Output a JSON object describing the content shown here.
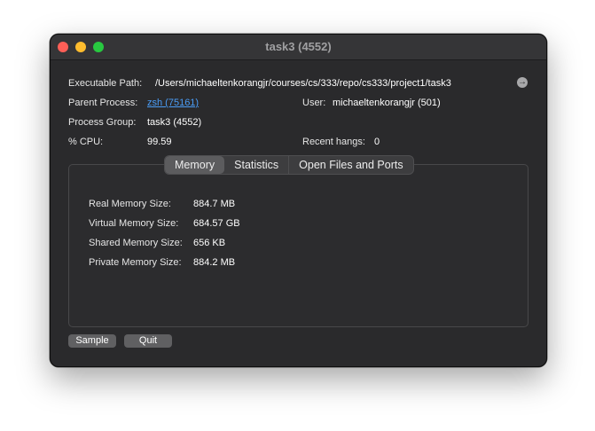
{
  "window": {
    "title": "task3 (4552)"
  },
  "info": {
    "executable_path_label": "Executable Path:",
    "executable_path_value": "/Users/michaeltenkorangjr/courses/cs/333/repo/cs333/project1/task3",
    "parent_process_label": "Parent Process:",
    "parent_process_value": "zsh (75161)",
    "user_label": "User:",
    "user_value": "michaeltenkorangjr (501)",
    "process_group_label": "Process Group:",
    "process_group_value": "task3 (4552)",
    "cpu_label": "% CPU:",
    "cpu_value": "99.59",
    "recent_hangs_label": "Recent hangs:",
    "recent_hangs_value": "0",
    "reveal_icon": "arrow-right-circle-icon"
  },
  "tabs": [
    {
      "label": "Memory",
      "selected": true
    },
    {
      "label": "Statistics",
      "selected": false
    },
    {
      "label": "Open Files and Ports",
      "selected": false
    }
  ],
  "memory": {
    "real_label": "Real Memory Size:",
    "real_value": "884.7 MB",
    "virtual_label": "Virtual Memory Size:",
    "virtual_value": "684.57 GB",
    "shared_label": "Shared Memory Size:",
    "shared_value": "656 KB",
    "private_label": "Private Memory Size:",
    "private_value": "884.2 MB"
  },
  "buttons": {
    "sample": "Sample",
    "quit": "Quit"
  }
}
